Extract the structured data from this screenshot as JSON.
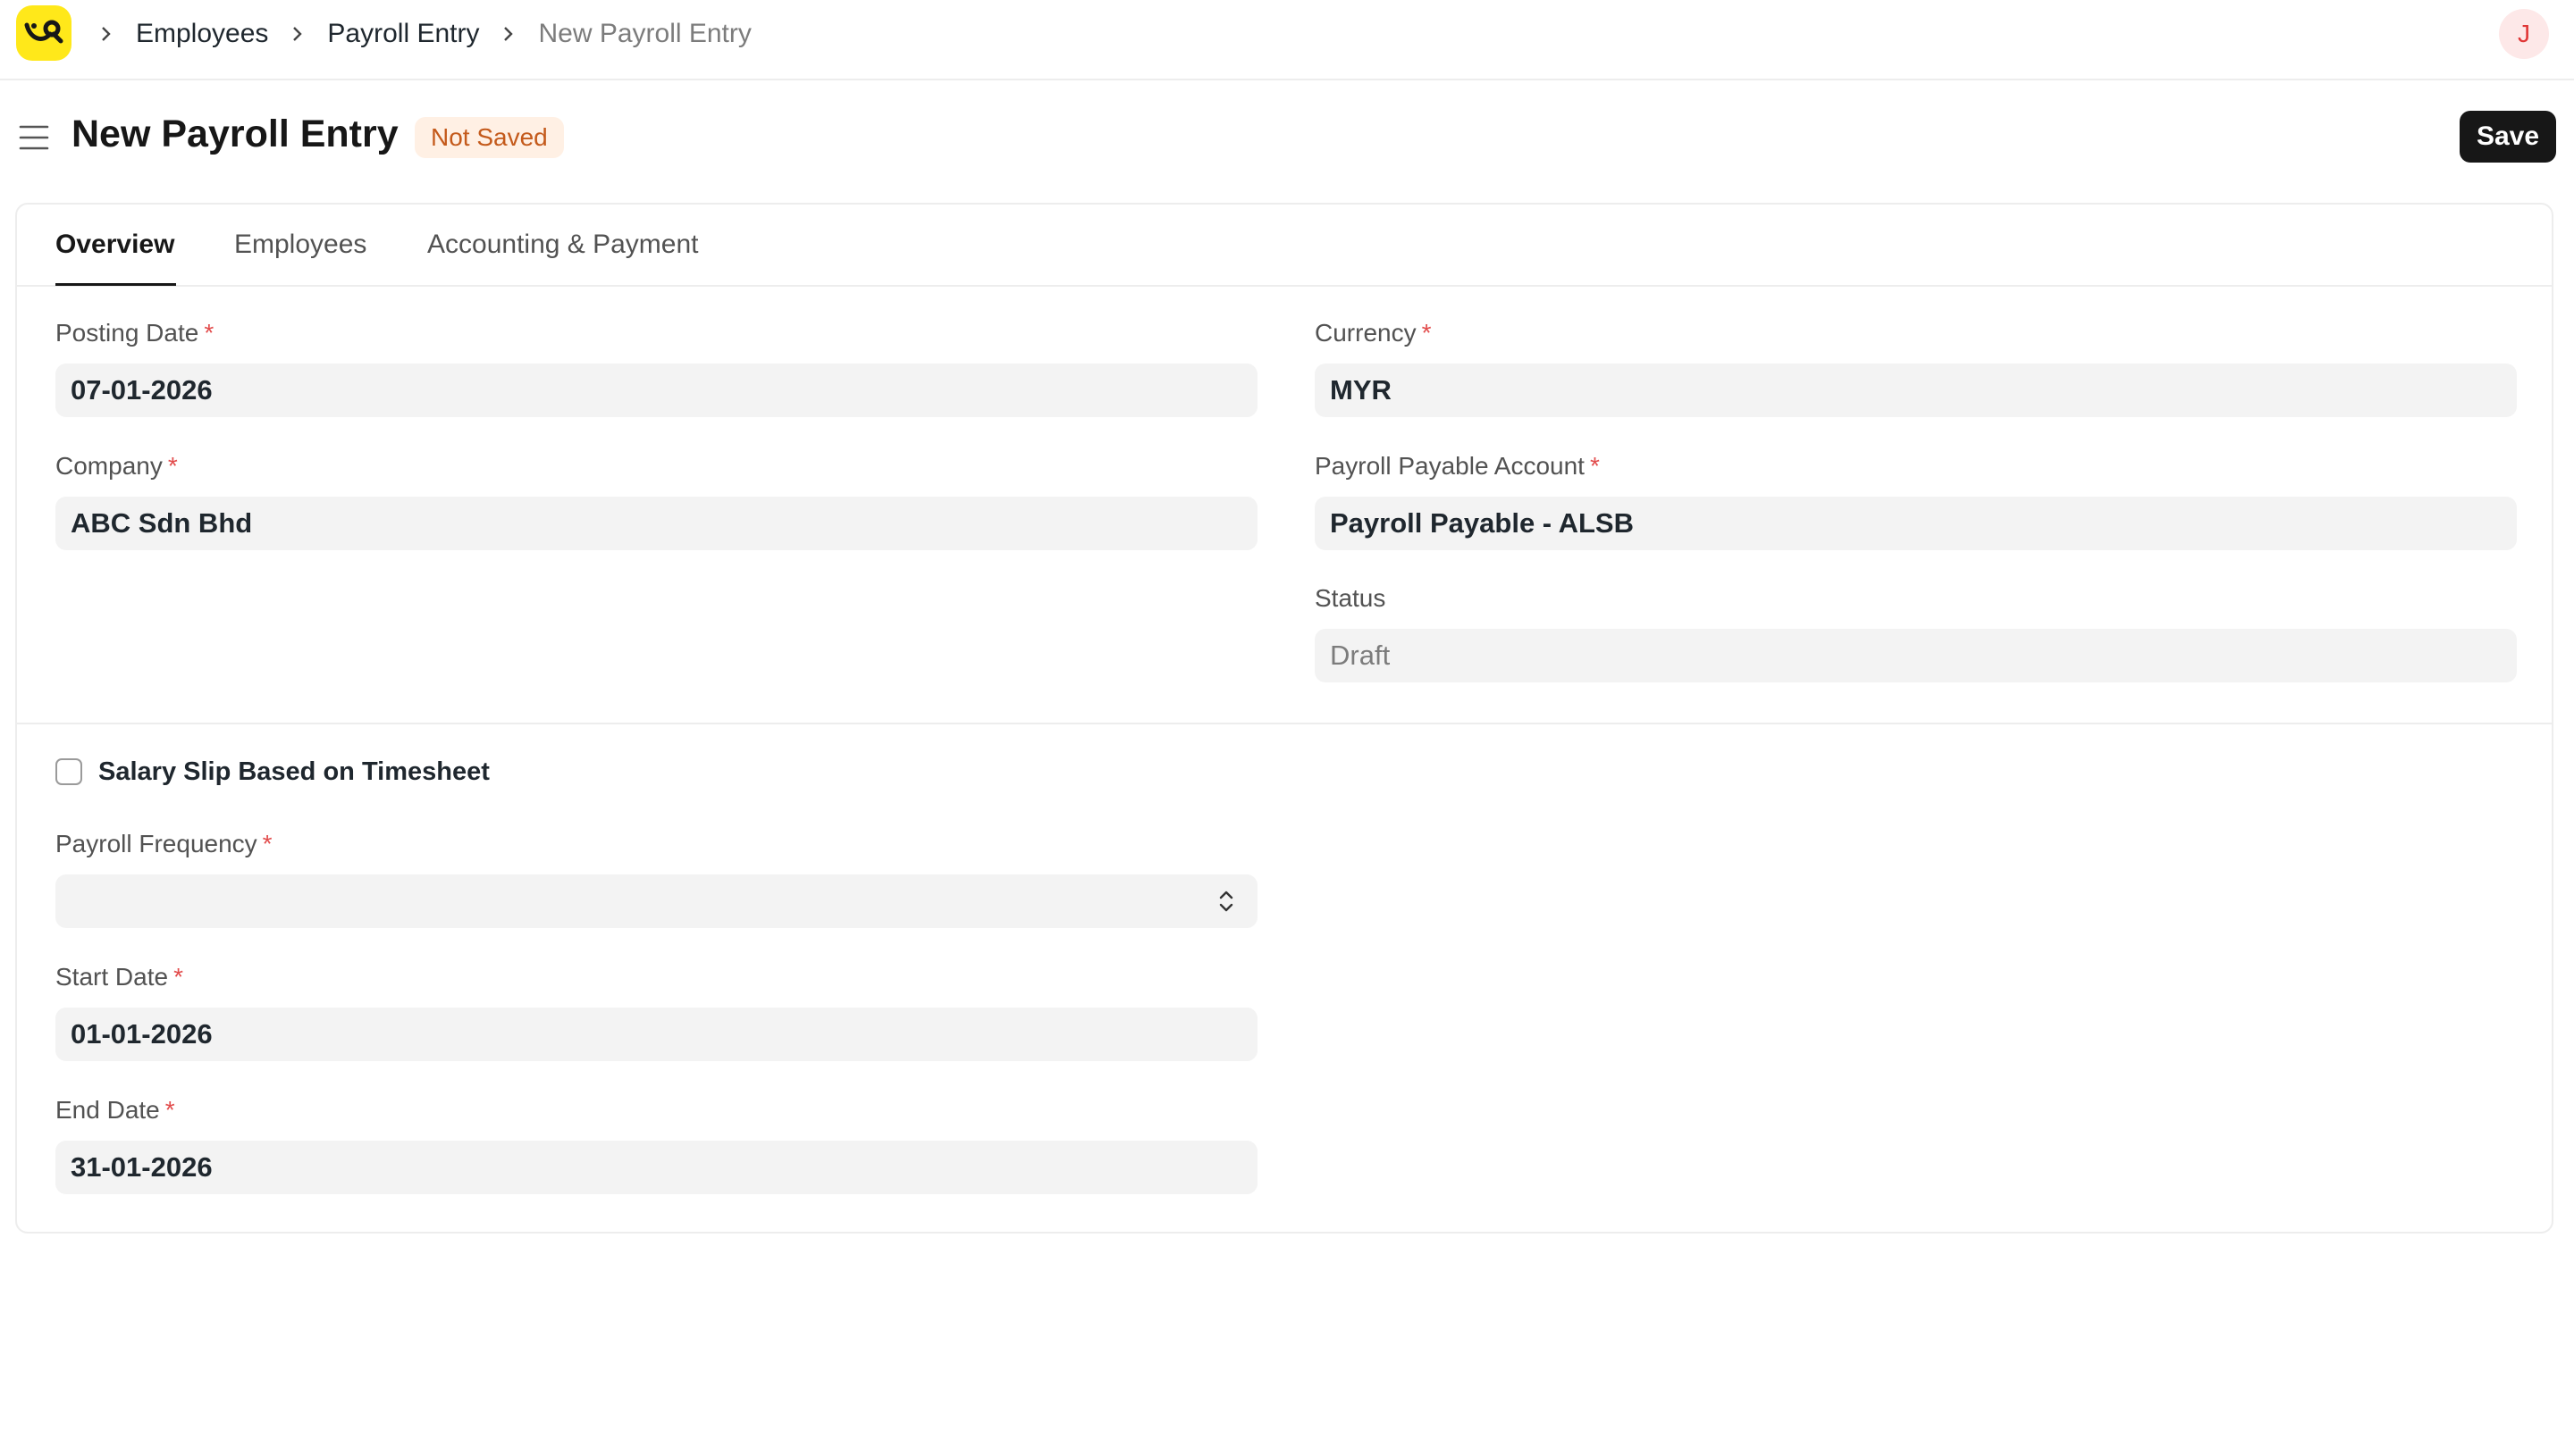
{
  "navbar": {
    "logo_icon": "smile-logo-icon",
    "breadcrumbs": [
      "Employees",
      "Payroll Entry",
      "New Payroll Entry"
    ],
    "avatar_initial": "J"
  },
  "page": {
    "title": "New Payroll Entry",
    "status": "Not Saved",
    "save_label": "Save"
  },
  "tabs": [
    {
      "label": "Overview",
      "active": true
    },
    {
      "label": "Employees",
      "active": false
    },
    {
      "label": "Accounting & Payment",
      "active": false
    }
  ],
  "form": {
    "posting_date": {
      "label": "Posting Date",
      "value": "07-01-2026",
      "required": true
    },
    "company": {
      "label": "Company",
      "value": "ABC Sdn Bhd",
      "required": true
    },
    "currency": {
      "label": "Currency",
      "value": "MYR",
      "required": true
    },
    "payroll_payable_account": {
      "label": "Payroll Payable Account",
      "value": "Payroll Payable - ALSB",
      "required": true
    },
    "status": {
      "label": "Status",
      "value": "Draft"
    },
    "salary_slip_timesheet": {
      "label": "Salary Slip Based on Timesheet",
      "checked": false
    },
    "payroll_frequency": {
      "label": "Payroll Frequency",
      "value": "",
      "required": true
    },
    "start_date": {
      "label": "Start Date",
      "value": "01-01-2026",
      "required": true
    },
    "end_date": {
      "label": "End Date",
      "value": "31-01-2026",
      "required": true
    }
  },
  "colors": {
    "logo_bg": "#ffe81a",
    "status_pill_bg": "#fff0e4",
    "status_pill_text": "#c45a1b",
    "primary_button": "#171717",
    "required_mark": "#e24c4c"
  }
}
